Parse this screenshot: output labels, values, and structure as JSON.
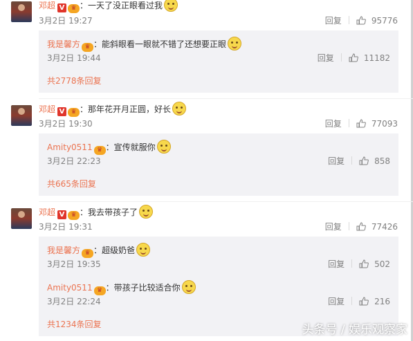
{
  "comments": [
    {
      "user": "邓超",
      "text": "：一天了没正眼看过我",
      "time": "3月2日 19:27",
      "reply_label": "回复",
      "likes": "95776",
      "replies": [
        {
          "user": "我是馨方",
          "text": "：能斜眼看一眼就不错了还想要正眼",
          "time": "3月2日 19:44",
          "reply_label": "回复",
          "likes": "11182"
        }
      ],
      "more": "共2778条回复"
    },
    {
      "user": "邓超",
      "text": "：那年花开月正圆，好长",
      "time": "3月2日 19:30",
      "reply_label": "回复",
      "likes": "77093",
      "replies": [
        {
          "user": "Amity0511",
          "text": "：宣传就服你",
          "time": "3月2日 22:23",
          "reply_label": "回复",
          "likes": "858"
        }
      ],
      "more": "共665条回复"
    },
    {
      "user": "邓超",
      "text": "：我去带孩子了",
      "time": "3月2日 19:31",
      "reply_label": "回复",
      "likes": "77426",
      "replies": [
        {
          "user": "我是馨方",
          "text": "：超级奶爸",
          "time": "3月2日 19:35",
          "reply_label": "回复",
          "likes": "502"
        },
        {
          "user": "Amity0511",
          "text": "：带孩子比较适合你",
          "time": "3月2日 22:24",
          "reply_label": "回复",
          "likes": "216"
        }
      ],
      "more": "共1234条回复"
    }
  ],
  "badges": {
    "v": "V",
    "vip": "♛"
  },
  "watermark": "头条号 / 娱乐观察家",
  "colors": {
    "username": "#eb7350",
    "reply_bg": "#f2f2f5",
    "meta": "#808080"
  },
  "icons": {
    "like": "thumbs-up-icon",
    "emoji": "doge-emoji-icon",
    "verified": "verified-v-icon",
    "vip": "vip-crown-icon"
  }
}
